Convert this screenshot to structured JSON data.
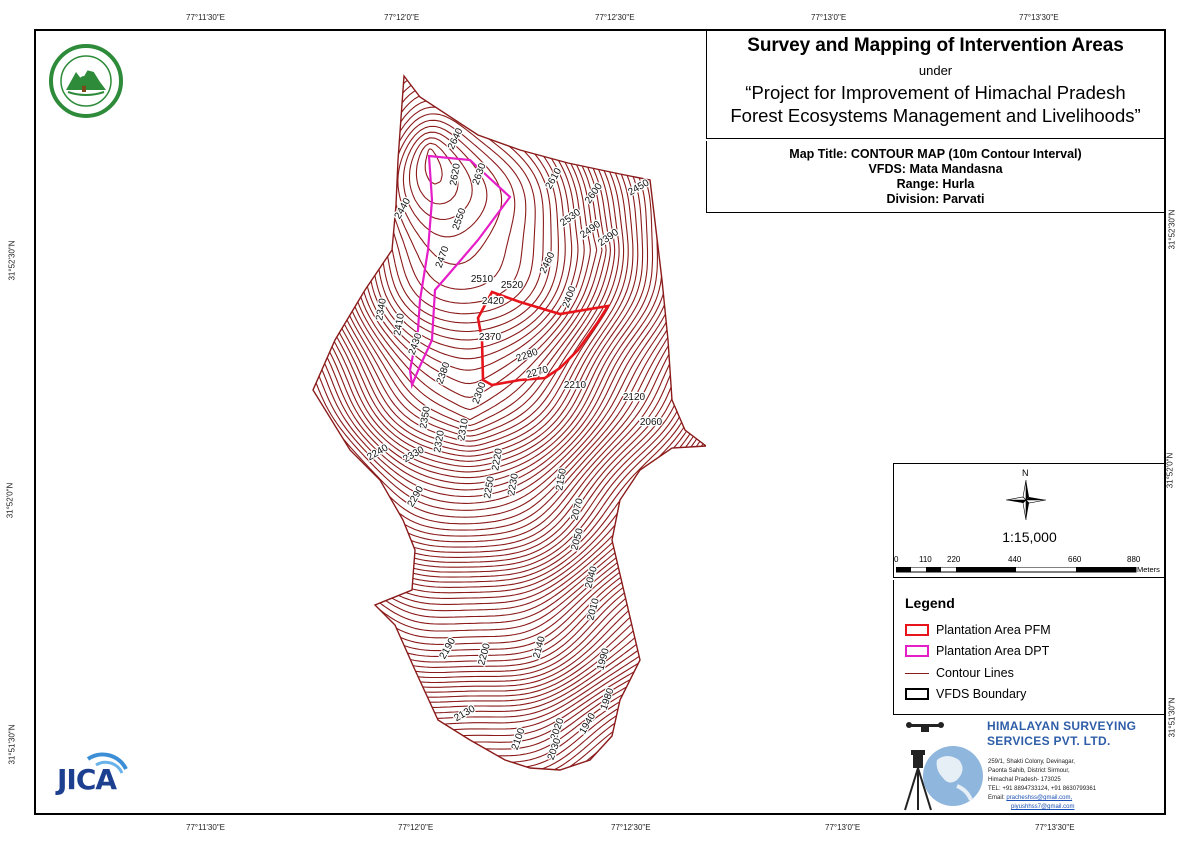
{
  "title": {
    "main": "Survey and Mapping of Intervention Areas",
    "under": "under",
    "project_line1": "“Project for Improvement of Himachal Pradesh",
    "project_line2": "Forest Ecosystems Management and Livelihoods”"
  },
  "info": {
    "map_title": "Map Title: CONTOUR MAP (10m Contour Interval)",
    "vfds": "VFDS: Mata Mandasna",
    "range": "Range: Hurla",
    "division": "Division: Parvati"
  },
  "graticule": {
    "top": [
      "77°11'30\"E",
      "77°12'0\"E",
      "77°12'30\"E",
      "77°13'0\"E",
      "77°13'30\"E"
    ],
    "bottom": [
      "77°11'30\"E",
      "77°12'0\"E",
      "77°12'30\"E",
      "77°13'0\"E",
      "77°13'30\"E"
    ],
    "left": [
      "31°52'30\"N",
      "31°52'0\"N",
      "31°51'30\"N"
    ],
    "right": [
      "31°52'30\"N",
      "31°52'0\"N",
      "31°51'30\"N"
    ]
  },
  "scale": {
    "north": "N",
    "ratio": "1:15,000",
    "ticks": [
      "0",
      "110",
      "220",
      "440",
      "660",
      "880"
    ],
    "unit": "Meters"
  },
  "legend": {
    "title": "Legend",
    "items": [
      {
        "label": "Plantation Area PFM",
        "color": "#e8141b",
        "kind": "box"
      },
      {
        "label": "Plantation Area DPT",
        "color": "#e61ec8",
        "kind": "box"
      },
      {
        "label": "Contour Lines",
        "color": "#8b1a1a",
        "kind": "line"
      },
      {
        "label": "VFDS Boundary",
        "color": "#000000",
        "kind": "box"
      }
    ]
  },
  "company": {
    "name_line1": "HIMALAYAN SURVEYING",
    "name_line2": "SERVICES PVT. LTD.",
    "addr1": "259/1, Shakti Colony, Devinagar,",
    "addr2": "Paonta Sahib, District Sirmour,",
    "addr3": "Himachal Pradesh- 173025",
    "tel": "TEL: +91 8894733124, +91 8630799361",
    "email_label": "Email: ",
    "email1": "pracheshss@gmail.com,",
    "email2": "piyushhss7@gmail.com"
  },
  "logos": {
    "jica_text": "JICA"
  },
  "contour_labels": [
    "2640",
    "2630",
    "2620",
    "2610",
    "2600",
    "2450",
    "2440",
    "2550",
    "2530",
    "2490",
    "2390",
    "2470",
    "2460",
    "2510",
    "2520",
    "2420",
    "2400",
    "2340",
    "2410",
    "2430",
    "2370",
    "2280",
    "2380",
    "2270",
    "2210",
    "2300",
    "2120",
    "2350",
    "2310",
    "2060",
    "2320",
    "2240",
    "2330",
    "2220",
    "2230",
    "2250",
    "2150",
    "2290",
    "2070",
    "2050",
    "2040",
    "2010",
    "2190",
    "2200",
    "2140",
    "1990",
    "1980",
    "2130",
    "2100",
    "2020",
    "1940",
    "2030"
  ],
  "colors": {
    "contour": "#8b1a1a",
    "pfm": "#e8141b",
    "dpt": "#e61ec8",
    "company_blue": "#2f5ea8",
    "jica_blue": "#1d3f8f",
    "hp_green": "#2e8b3a"
  }
}
